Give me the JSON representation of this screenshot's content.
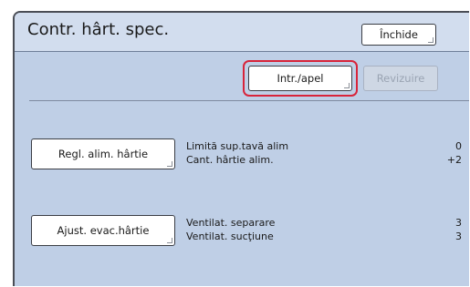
{
  "header": {
    "title": "Contr. hârt. spec.",
    "close_label": "Închide"
  },
  "toolbar": {
    "call_label": "Intr./apel",
    "review_label": "Revizuire",
    "review_enabled": false,
    "highlight_color": "#d8243a"
  },
  "feed": {
    "button_label": "Regl. alim. hârtie",
    "rows": [
      {
        "label": "Limită sup.tavă alim",
        "value": "0"
      },
      {
        "label": "Cant. hârtie alim.",
        "value": "+2"
      }
    ]
  },
  "eject": {
    "button_label": "Ajust. evac.hârtie",
    "rows": [
      {
        "label": "Ventilat. separare",
        "value": "3"
      },
      {
        "label": "Ventilat. sucţiune",
        "value": "3"
      }
    ]
  },
  "colors": {
    "panel_bg": "#bfcfe6",
    "header_bg": "#d2ddee",
    "frame_border": "#4a4d55"
  }
}
